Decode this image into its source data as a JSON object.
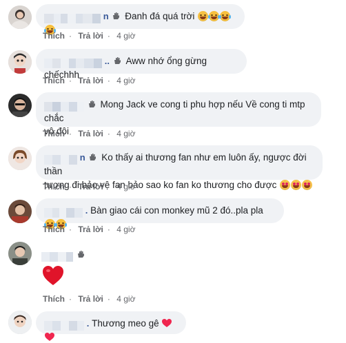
{
  "comments": [
    {
      "text": "Đanh đá quá trời",
      "name_tail": "n",
      "emojis": [
        "laugh-sweat",
        "laugh",
        "laugh",
        "laugh"
      ]
    },
    {
      "text": "Aww nhớ ổng gừng chếchhh",
      "name_tail": "..",
      "emojis": []
    },
    {
      "text_line1": "Mong Jack ve cong ti phu hợp nếu Về cong ti mtp chắc",
      "text_line2": "vô đôi",
      "emojis": []
    },
    {
      "name_tail": "n",
      "text_line1": "Ko thấy ai thương fan như em luôn ấy, ngược đời thần",
      "text_line2": "tượng đi bảo vệ fan bảo sao ko fan ko thương cho được",
      "emojis": [
        "heart-eyes",
        "heart-eyes",
        "heart-eyes"
      ]
    },
    {
      "name_tail": ".",
      "text": "Bàn giao cái con monkey mũ 2 đó..pla pla",
      "emojis": [
        "laugh",
        "laugh"
      ]
    },
    {
      "text": "",
      "emojis": [],
      "big_heart": true
    },
    {
      "name_tail": ".",
      "text": "Thương meo gê",
      "emojis": [
        "heart",
        "heart"
      ]
    }
  ],
  "actions": {
    "like": "Thích",
    "reply": "Trả lời",
    "dot": "·"
  },
  "times": [
    "4 giờ",
    "4 giờ",
    "4 giờ",
    "4 giờ",
    "4 giờ",
    "4 giờ"
  ],
  "colors": {
    "bubble": "#f0f2f5",
    "link": "#385898",
    "meta": "#65676b"
  }
}
